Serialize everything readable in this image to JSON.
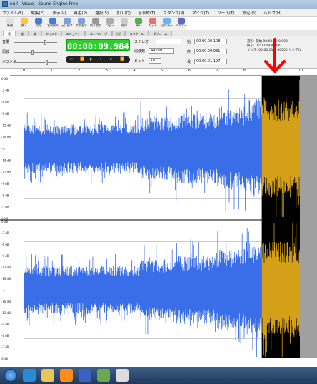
{
  "window": {
    "title": "null - Wave - Sound Engine Free"
  },
  "menu": {
    "items": [
      "ファイル(F)",
      "編集(E)",
      "表示(V)",
      "再生(P)",
      "選択(S)",
      "加工(Q)",
      "音合成(T)",
      "スタンプ(R)",
      "マイク(T)",
      "ツール(T)",
      "設定(O)",
      "ヘルプ(H)"
    ]
  },
  "toolbar": {
    "buttons": [
      {
        "label": "新規",
        "icon": "new-file-icon"
      },
      {
        "label": "開く",
        "icon": "open-folder-icon"
      },
      {
        "label": "保存",
        "icon": "save-icon"
      },
      {
        "label": "名前保存",
        "icon": "save-as-icon"
      },
      {
        "label": "元に戻す",
        "icon": "undo-icon"
      },
      {
        "label": "やり直す",
        "icon": "redo-icon"
      },
      {
        "label": "切り取り",
        "icon": "cut-icon"
      },
      {
        "label": "コピー",
        "icon": "copy-icon"
      },
      {
        "label": "貼付",
        "icon": "paste-icon"
      },
      {
        "label": "挿入",
        "icon": "insert-icon"
      },
      {
        "label": "カット",
        "icon": "trim-icon"
      },
      {
        "label": "全体表示",
        "icon": "zoom-fit-icon"
      },
      {
        "label": "ミキサー",
        "icon": "mixer-icon"
      }
    ]
  },
  "tabs": [
    "音",
    "波",
    "編",
    "フィルタ",
    "エフェクト",
    "エンベロープ",
    "分析",
    "スペクトル",
    "ボリューム"
  ],
  "panel": {
    "labels": [
      "音量",
      "周波",
      "バランス"
    ],
    "timer": "00:00:09.984",
    "transport": [
      "⏮",
      "⏪",
      "▶",
      "⏸",
      "⏹",
      "⏩"
    ],
    "format_label": "ステレオ",
    "rate_label": "周波数",
    "rate_value": "44100",
    "bits_label": "ビット",
    "bits_value": "16",
    "time_start_label": "始",
    "time_start": "00.00.00.108",
    "time_end_label": "終",
    "time_end": "00.00.09.981",
    "time_len_label": "長",
    "time_len": "00.00.01.197",
    "info_lines": [
      "選択: 開始 00:00:09.0 000",
      "終了: 00:00:09.9 000",
      "サイズ: 00:00:01:5 00000 サンプル"
    ]
  },
  "ruler": {
    "ticks": [
      "0",
      "1",
      "2",
      "3",
      "4",
      "5",
      "6",
      "7",
      "8",
      "9",
      "10"
    ]
  },
  "waveform": {
    "db_labels": [
      "0 dB",
      "-3 dB",
      "-6 dB",
      "-9 dB",
      "-12 dB",
      "-18 dB",
      "-∞",
      "-18 dB",
      "-12 dB",
      "-9 dB",
      "-6 dB",
      "-3 dB",
      "0 dB"
    ],
    "wave_color": "#3a6ee8",
    "selected_wave_color": "#d4a017",
    "selected_bg": "#000000",
    "selection_start_sec": 8.6,
    "selection_end_sec": 9.98,
    "duration_sec": 9.98,
    "annotation_arrow_color": "#ff0000"
  },
  "taskbar": {
    "icons": [
      "ie-icon",
      "folder-icon",
      "media-player-icon",
      "word-icon",
      "tool-icon",
      "sound-engine-icon"
    ]
  }
}
